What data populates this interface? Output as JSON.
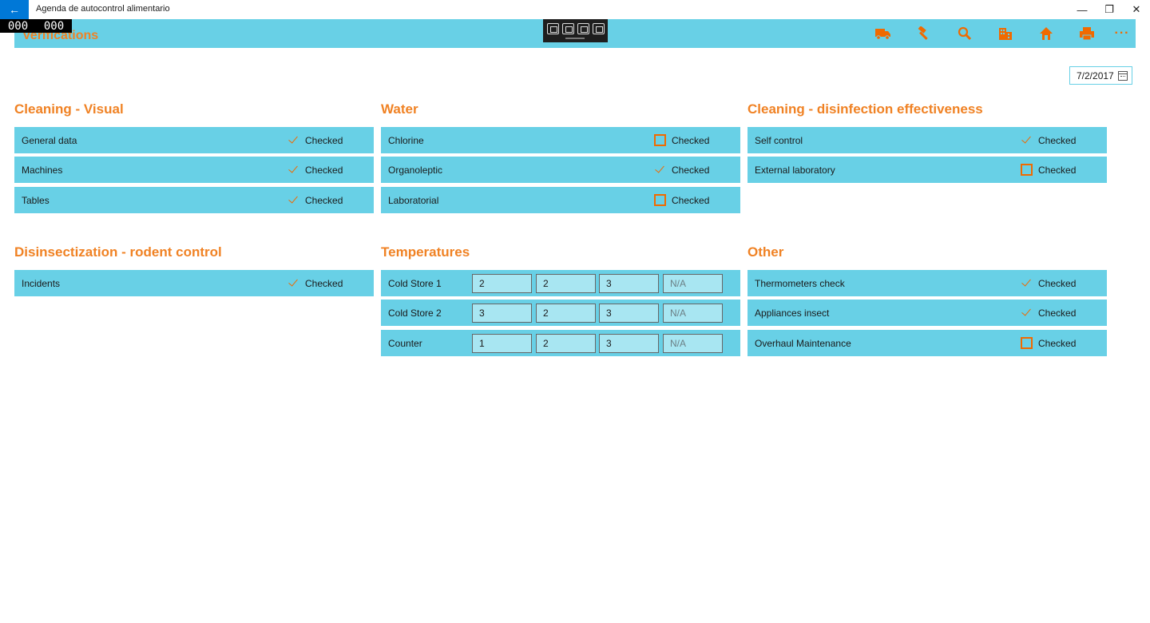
{
  "window": {
    "back_glyph": "←",
    "title": "Agenda de autocontrol alimentario",
    "minimize_glyph": "—",
    "maximize_glyph": "❐",
    "close_glyph": "✕"
  },
  "counter": {
    "left": "000",
    "right": "000"
  },
  "header": {
    "title": "Verifications",
    "accent_color": "#f06a00",
    "bar_color": "#68d0e6",
    "actions": [
      {
        "name": "truck-icon",
        "label": "Suppliers"
      },
      {
        "name": "hammer-icon",
        "label": "Maintenance"
      },
      {
        "name": "search-icon",
        "label": "Search"
      },
      {
        "name": "building-icon",
        "label": "Establishment"
      },
      {
        "name": "home-icon",
        "label": "Home"
      },
      {
        "name": "printer-icon",
        "label": "Print"
      }
    ],
    "more_glyph": "···"
  },
  "date": {
    "value": "7/2/2017"
  },
  "sections": {
    "cleaning_visual": {
      "title": "Cleaning - Visual",
      "rows": [
        {
          "label": "General data",
          "checked": true,
          "check_label": "Checked"
        },
        {
          "label": "Machines",
          "checked": true,
          "check_label": "Checked"
        },
        {
          "label": "Tables",
          "checked": true,
          "check_label": "Checked"
        }
      ]
    },
    "water": {
      "title": "Water",
      "rows": [
        {
          "label": "Chlorine",
          "checked": false,
          "check_label": "Checked"
        },
        {
          "label": "Organoleptic",
          "checked": true,
          "check_label": "Checked"
        },
        {
          "label": "Laboratorial",
          "checked": false,
          "check_label": "Checked"
        }
      ]
    },
    "cleaning_disinfection": {
      "title": "Cleaning - disinfection effectiveness",
      "rows": [
        {
          "label": "Self control",
          "checked": true,
          "check_label": "Checked"
        },
        {
          "label": "External laboratory",
          "checked": false,
          "check_label": "Checked"
        }
      ]
    },
    "disinsectization": {
      "title": "Disinsectization - rodent control",
      "rows": [
        {
          "label": "Incidents",
          "checked": true,
          "check_label": "Checked"
        }
      ]
    },
    "temperatures": {
      "title": "Temperatures",
      "rows": [
        {
          "label": "Cold Store 1",
          "values": [
            "2",
            "2",
            "3"
          ],
          "placeholder": "N/A"
        },
        {
          "label": "Cold Store 2",
          "values": [
            "3",
            "2",
            "3"
          ],
          "placeholder": "N/A"
        },
        {
          "label": "Counter",
          "values": [
            "1",
            "2",
            "3"
          ],
          "placeholder": "N/A"
        }
      ]
    },
    "other": {
      "title": "Other",
      "rows": [
        {
          "label": "Thermometers check",
          "checked": true,
          "check_label": "Checked"
        },
        {
          "label": "Appliances insect",
          "checked": true,
          "check_label": "Checked"
        },
        {
          "label": "Overhaul Maintenance",
          "checked": false,
          "check_label": "Checked"
        }
      ]
    }
  }
}
